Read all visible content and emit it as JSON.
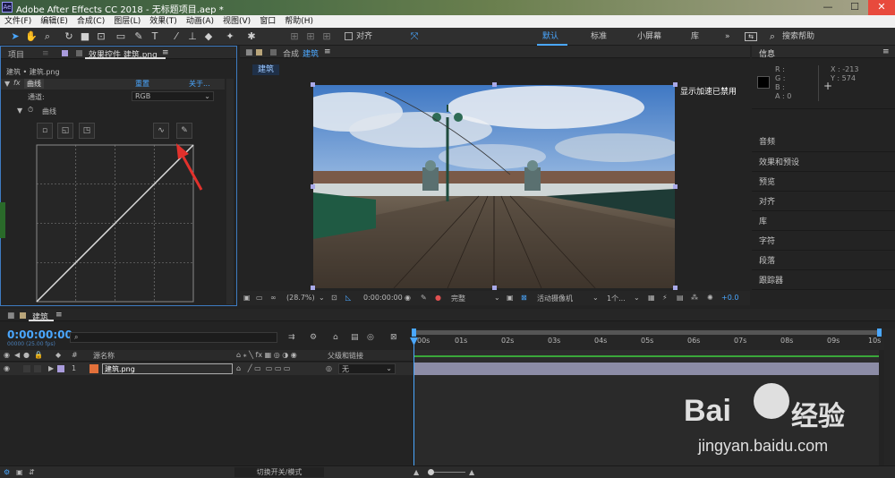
{
  "app": {
    "title": "Adobe After Effects CC 2018 - 无标题项目.aep *",
    "logo_text": "Ae"
  },
  "window_controls": {
    "minimize": "—",
    "maximize": "☐",
    "close": "✕"
  },
  "menu": [
    "文件(F)",
    "编辑(E)",
    "合成(C)",
    "图层(L)",
    "效果(T)",
    "动画(A)",
    "视图(V)",
    "窗口",
    "帮助(H)"
  ],
  "toolbar": {
    "align_label": "对齐",
    "workspaces": [
      "默认",
      "标准",
      "小屏幕",
      "库"
    ],
    "workspace_more": "»",
    "search_placeholder": "搜索帮助"
  },
  "project_panel": {
    "tab_project": "项目",
    "tab_effects": "效果控件 建筑.png",
    "breadcrumb": "建筑 • 建筑.png",
    "effect_name": "曲线",
    "reset_label": "重置",
    "about_label": "关于...",
    "channel_label": "通道:",
    "channel_value": "RGB",
    "curves_label": "曲线"
  },
  "composition": {
    "tab_label": "合成",
    "comp_name": "建筑",
    "sub_tab": "建筑",
    "gpu_notice": "显示加速已禁用",
    "zoom": "(28.7%)",
    "timecode": "0:00:00:00",
    "resolution": "完整",
    "camera": "活动摄像机",
    "views": "1个...",
    "exposure": "+0.0"
  },
  "info_panel": {
    "title": "信息",
    "r": "R :",
    "g": "G :",
    "b": "B :",
    "a": "A : 0",
    "x": "X : -213",
    "y": "Y : 574",
    "panels": [
      "音频",
      "效果和预设",
      "预览",
      "对齐",
      "库",
      "字符",
      "段落",
      "跟踪器"
    ]
  },
  "timeline": {
    "comp_tab": "建筑",
    "timecode": "0:00:00:00",
    "fps": "00000 (25.00 fps)",
    "search_placeholder": "",
    "columns": {
      "num": "#",
      "source": "源名称",
      "parent": "父级和链接"
    },
    "layer": {
      "index": "1",
      "name": "建筑.png",
      "parent": "无"
    },
    "ruler": [
      "00s",
      "01s",
      "02s",
      "03s",
      "04s",
      "05s",
      "06s",
      "07s",
      "08s",
      "09s",
      "10s"
    ]
  },
  "status_bar": {
    "toggle_label": "切换开关/模式"
  },
  "watermark": {
    "line1": "Bai",
    "logo": "经验",
    "line2": "jingyan.baidu.com"
  },
  "colors": {
    "accent": "#4aa7ff",
    "panel": "#232323",
    "layer_bar": "#8c8ca6",
    "playhead": "#4aa7ff",
    "arrow": "#e2312c"
  }
}
